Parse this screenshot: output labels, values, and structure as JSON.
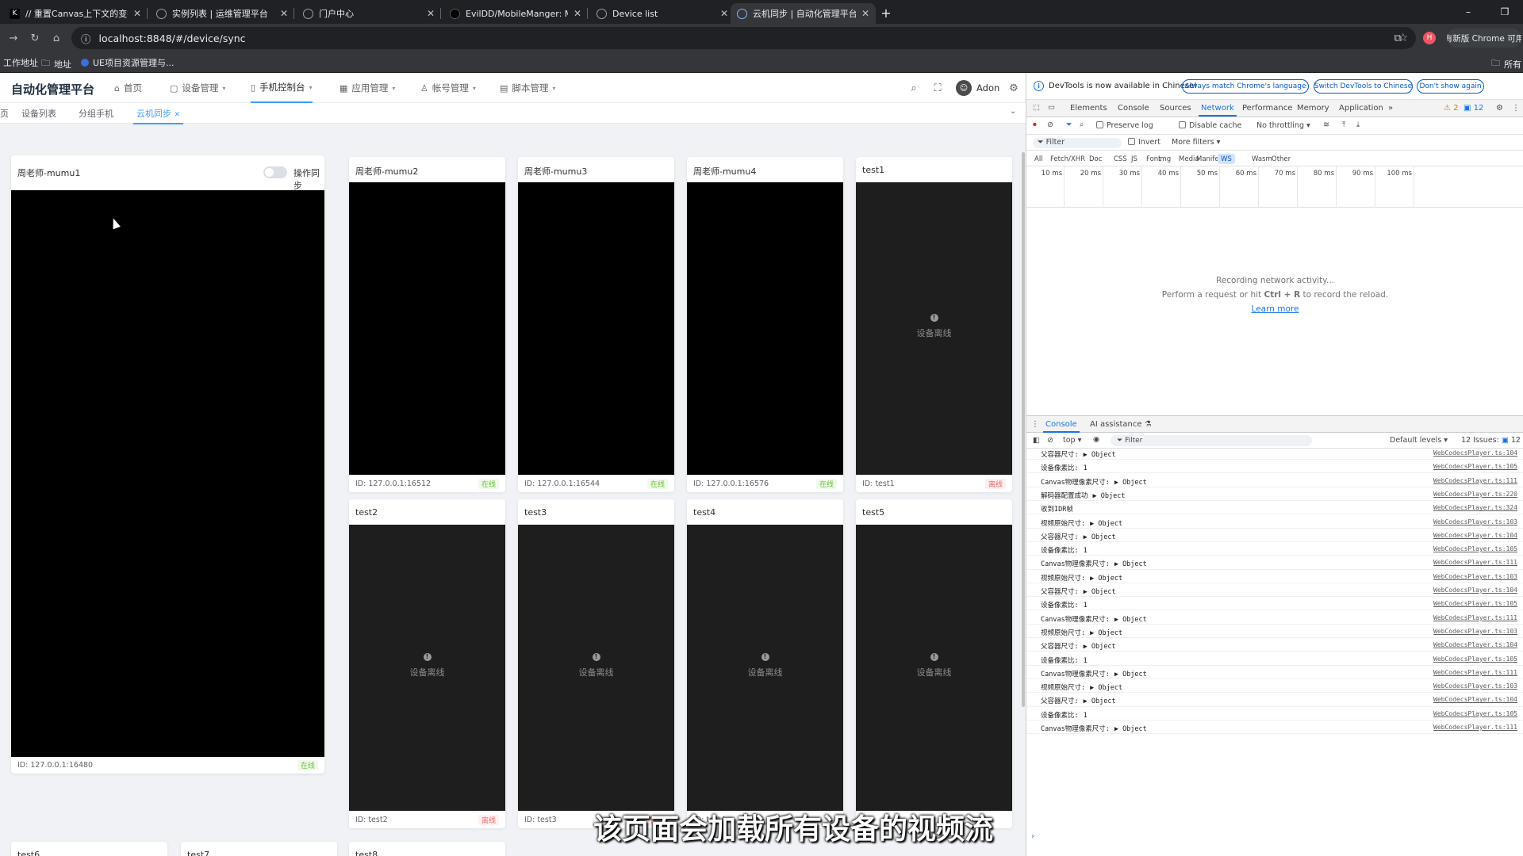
{
  "browser": {
    "tabs": [
      {
        "title": "// 重置Canvas上下文的变换 if",
        "icon": "K"
      },
      {
        "title": "实例列表 | 运维管理平台",
        "icon": ""
      },
      {
        "title": "门户中心",
        "icon": ""
      },
      {
        "title": "EvilDD/MobileManger: Mobi",
        "icon": ""
      },
      {
        "title": "Device list",
        "icon": ""
      },
      {
        "title": "云机同步 | 自动化管理平台",
        "icon": ""
      }
    ],
    "active_tab": 5,
    "url": "localhost:8848/#/device/sync",
    "profile_label": "有新版 Chrome 可用",
    "bookmarks": [
      "工作地址",
      "地址",
      "UE项目资源管理与...",
      "所有"
    ],
    "window_controls": [
      "–",
      "❐"
    ]
  },
  "app": {
    "logo": "自动化管理平台",
    "menu": [
      {
        "label": "首页",
        "icon": "home-icon"
      },
      {
        "label": "设备管理",
        "icon": "device-icon"
      },
      {
        "label": "手机控制台",
        "icon": "phone-icon"
      },
      {
        "label": "应用管理",
        "icon": "grid-icon"
      },
      {
        "label": "帐号管理",
        "icon": "user-icon"
      },
      {
        "label": "脚本管理",
        "icon": "script-icon"
      }
    ],
    "active_menu": 2,
    "username": "Adon",
    "tags": [
      "页",
      "设备列表",
      "分组手机",
      "云机同步"
    ],
    "active_tag": 3,
    "sync_label": "操作同步",
    "offline_text": "设备离线",
    "status_online": "在线",
    "status_offline": "离线",
    "main_device": {
      "name": "周老师-mumu1",
      "id": "ID: 127.0.0.1:16480",
      "status": "在线"
    },
    "devices": [
      {
        "name": "周老师-mumu2",
        "id": "ID: 127.0.0.1:16512",
        "status": "在线",
        "online": true
      },
      {
        "name": "周老师-mumu3",
        "id": "ID: 127.0.0.1:16544",
        "status": "在线",
        "online": true
      },
      {
        "name": "周老师-mumu4",
        "id": "ID: 127.0.0.1:16576",
        "status": "在线",
        "online": true
      },
      {
        "name": "test1",
        "id": "ID: test1",
        "status": "离线",
        "online": false
      },
      {
        "name": "test2",
        "id": "ID: test2",
        "status": "离线",
        "online": false
      },
      {
        "name": "test3",
        "id": "ID: test3",
        "status": "离线",
        "online": false
      },
      {
        "name": "test4",
        "id": "ID: test4",
        "status": "",
        "online": false
      },
      {
        "name": "test5",
        "id": "",
        "status": "",
        "online": false
      }
    ],
    "bottom_devices": [
      "test6",
      "test7",
      "test8"
    ],
    "subtitle": "该页面会加载所有设备的视频流"
  },
  "devtools": {
    "info": "DevTools is now available in Chinese!",
    "info_buttons": [
      "Always match Chrome's language",
      "Switch DevTools to Chinese",
      "Don't show again"
    ],
    "tabs": [
      "Elements",
      "Console",
      "Sources",
      "Network",
      "Performance",
      "Memory",
      "Application"
    ],
    "active_tab": 3,
    "warnings": "2",
    "issues_count": "12",
    "preserve_log": "Preserve log",
    "disable_cache": "Disable cache",
    "throttling": "No throttling",
    "filter_placeholder": "Filter",
    "invert": "Invert",
    "more_filters": "More filters",
    "filter_types": [
      "All",
      "Fetch/XHR",
      "Doc",
      "CSS",
      "JS",
      "Font",
      "Img",
      "Media",
      "Manifest",
      "WS",
      "Wasm",
      "Other"
    ],
    "active_filter": 9,
    "timeline_ticks": [
      "10 ms",
      "20 ms",
      "30 ms",
      "40 ms",
      "50 ms",
      "60 ms",
      "70 ms",
      "80 ms",
      "90 ms",
      "100 ms"
    ],
    "recording": "Recording network activity...",
    "perform_pre": "Perform a request or hit ",
    "perform_key": "Ctrl + R",
    "perform_post": " to record the reload.",
    "learn_more": "Learn more",
    "drawer_tabs": [
      "Console",
      "AI assistance"
    ],
    "console_context": "top",
    "console_filter": "Filter",
    "default_levels": "Default levels",
    "issues_label": "12 Issues:",
    "issues_badge": "12",
    "logs": [
      {
        "msg": "父容器尺寸:",
        "obj": "▶ Object",
        "src": "WebCodecsPlayer.ts:104"
      },
      {
        "msg": "设备像素比:",
        "obj": "1",
        "src": "WebCodecsPlayer.ts:105"
      },
      {
        "msg": "Canvas物理像素尺寸:",
        "obj": "▶ Object",
        "src": "WebCodecsPlayer.ts:111"
      },
      {
        "msg": "解码器配置成功",
        "obj": "▶ Object",
        "src": "WebCodecsPlayer.ts:220"
      },
      {
        "msg": "收到IDR帧",
        "obj": "",
        "src": "WebCodecsPlayer.ts:324"
      },
      {
        "msg": "视频原始尺寸:",
        "obj": "▶ Object",
        "src": "WebCodecsPlayer.ts:103"
      },
      {
        "msg": "父容器尺寸:",
        "obj": "▶ Object",
        "src": "WebCodecsPlayer.ts:104"
      },
      {
        "msg": "设备像素比:",
        "obj": "1",
        "src": "WebCodecsPlayer.ts:105"
      },
      {
        "msg": "Canvas物理像素尺寸:",
        "obj": "▶ Object",
        "src": "WebCodecsPlayer.ts:111"
      },
      {
        "msg": "视频原始尺寸:",
        "obj": "▶ Object",
        "src": "WebCodecsPlayer.ts:103"
      },
      {
        "msg": "父容器尺寸:",
        "obj": "▶ Object",
        "src": "WebCodecsPlayer.ts:104"
      },
      {
        "msg": "设备像素比:",
        "obj": "1",
        "src": "WebCodecsPlayer.ts:105"
      },
      {
        "msg": "Canvas物理像素尺寸:",
        "obj": "▶ Object",
        "src": "WebCodecsPlayer.ts:111"
      },
      {
        "msg": "视频原始尺寸:",
        "obj": "▶ Object",
        "src": "WebCodecsPlayer.ts:103"
      },
      {
        "msg": "父容器尺寸:",
        "obj": "▶ Object",
        "src": "WebCodecsPlayer.ts:104"
      },
      {
        "msg": "设备像素比:",
        "obj": "1",
        "src": "WebCodecsPlayer.ts:105"
      },
      {
        "msg": "Canvas物理像素尺寸:",
        "obj": "▶ Object",
        "src": "WebCodecsPlayer.ts:111"
      },
      {
        "msg": "视频原始尺寸:",
        "obj": "▶ Object",
        "src": "WebCodecsPlayer.ts:103"
      },
      {
        "msg": "父容器尺寸:",
        "obj": "▶ Object",
        "src": "WebCodecsPlayer.ts:104"
      },
      {
        "msg": "设备像素比:",
        "obj": "1",
        "src": "WebCodecsPlayer.ts:105"
      },
      {
        "msg": "Canvas物理像素尺寸:",
        "obj": "▶ Object",
        "src": "WebCodecsPlayer.ts:111"
      }
    ]
  },
  "colors": {
    "accent": "#409eff",
    "online": "#67c23a",
    "offline": "#f56c6c",
    "devtools_accent": "#1a73e8"
  }
}
